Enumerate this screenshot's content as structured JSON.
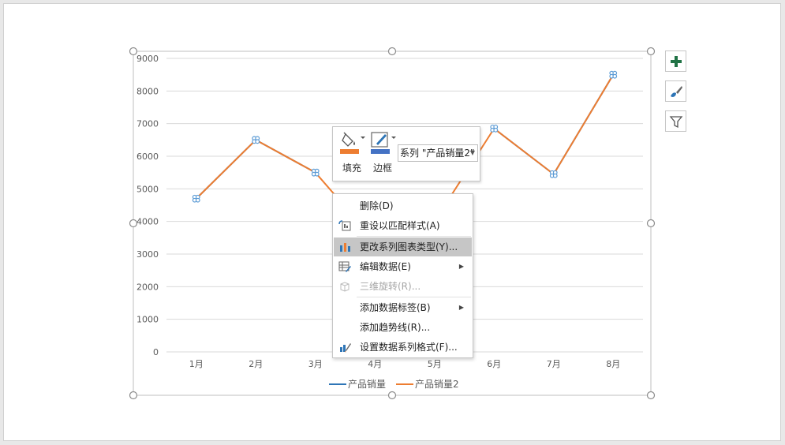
{
  "chart_data": {
    "type": "line",
    "categories": [
      "1月",
      "2月",
      "3月",
      "4月",
      "5月",
      "6月",
      "7月",
      "8月"
    ],
    "series": [
      {
        "name": "产品销量",
        "values": [
          4700,
          6500,
          5500,
          null,
          null,
          6850,
          5450,
          8500
        ],
        "color": "#2e75b6"
      },
      {
        "name": "产品销量2",
        "values": [
          4700,
          6500,
          5500,
          3400,
          4000,
          6850,
          5450,
          8500
        ],
        "color": "#ed7d31",
        "selected": true
      }
    ],
    "ylim": [
      0,
      9000
    ],
    "yticks": [
      "0",
      "1000",
      "2000",
      "3000",
      "4000",
      "5000",
      "6000",
      "7000",
      "8000",
      "9000"
    ],
    "grid": true,
    "legend_position": "bottom",
    "marker_color": "#5b9bd5"
  },
  "side_buttons": {
    "elements": "plus-icon",
    "styles": "brush-icon",
    "filters": "filter-icon"
  },
  "mini_toolbar": {
    "fill_label": "填充",
    "outline_label": "边框",
    "series_select": "系列 \"产品销量2\"",
    "fill_color": "#ed7d31",
    "outline_color": "#4472c4"
  },
  "context_menu": {
    "items": [
      {
        "label": "删除(D)",
        "icon": ""
      },
      {
        "label": "重设以匹配样式(A)",
        "icon": "reset-style-icon"
      },
      {
        "label": "更改系列图表类型(Y)...",
        "icon": "chart-type-icon",
        "highlighted": true
      },
      {
        "label": "编辑数据(E)",
        "icon": "edit-data-icon",
        "submenu": true
      },
      {
        "label": "三维旋转(R)...",
        "icon": "rotate-3d-icon",
        "disabled": true
      },
      {
        "label": "添加数据标签(B)",
        "icon": "",
        "submenu": true
      },
      {
        "label": "添加趋势线(R)...",
        "icon": ""
      },
      {
        "label": "设置数据系列格式(F)...",
        "icon": "format-series-icon"
      }
    ]
  }
}
